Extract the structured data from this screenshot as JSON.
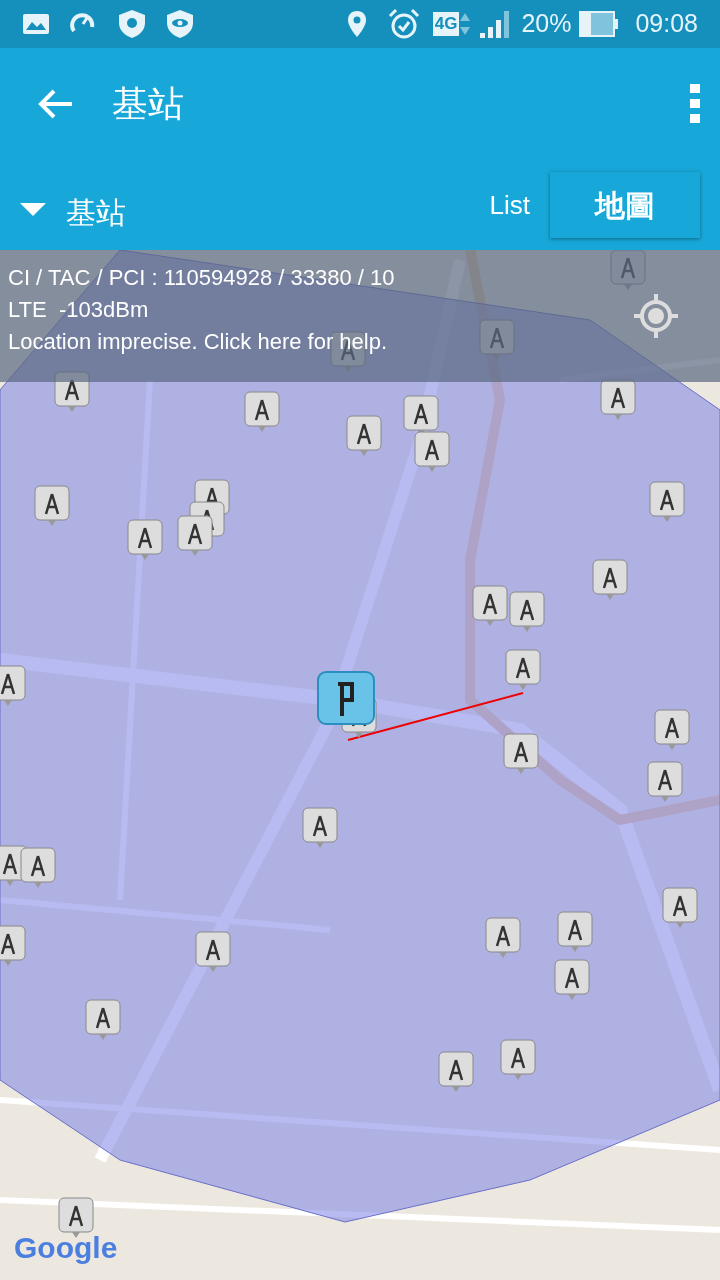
{
  "status_bar": {
    "network_type": "4G",
    "battery": "20%",
    "time": "09:08"
  },
  "toolbar": {
    "title": "基站"
  },
  "subbar": {
    "dropdown": "基站",
    "tabs": [
      {
        "label": "List",
        "selected": false
      },
      {
        "label": "地圖",
        "selected": true
      }
    ]
  },
  "info": {
    "lines": [
      "CI / TAC / PCI : 110594928 / 33380 / 10",
      "LTE  -103dBm",
      "Location imprecise. Click here for help."
    ]
  },
  "map": {
    "attribution": "Google"
  }
}
